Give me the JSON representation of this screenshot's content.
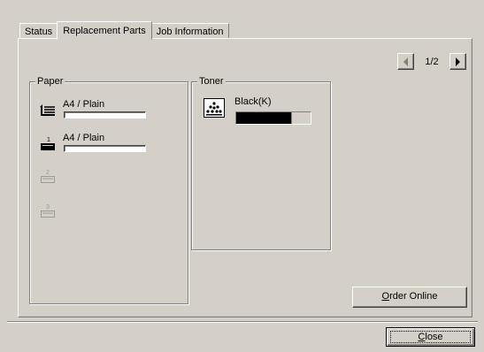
{
  "tabs": [
    {
      "label": "Status",
      "active": false
    },
    {
      "label": "Replacement Parts",
      "active": true
    },
    {
      "label": "Job Information",
      "active": false
    }
  ],
  "pagination": {
    "current": "1/2",
    "prev_icon": "arrow-left-icon",
    "next_icon": "arrow-right-icon"
  },
  "paper": {
    "title": "Paper",
    "trays": [
      {
        "label": "A4 / Plain",
        "icon": "bypass-tray-icon",
        "enabled": true
      },
      {
        "label": "A4 / Plain",
        "icon": "tray-1-icon",
        "enabled": true
      },
      {
        "label": "",
        "icon": "tray-2-icon",
        "enabled": false
      },
      {
        "label": "",
        "icon": "tray-3-icon",
        "enabled": false
      }
    ]
  },
  "toner": {
    "title": "Toner",
    "items": [
      {
        "label": "Black(K)",
        "level": 0.75,
        "icon": "toner-cartridge-icon"
      }
    ]
  },
  "buttons": {
    "order_online": {
      "label": "Order Online",
      "mnemonic": "O"
    },
    "close": {
      "label": "Close",
      "mnemonic": "C"
    }
  }
}
